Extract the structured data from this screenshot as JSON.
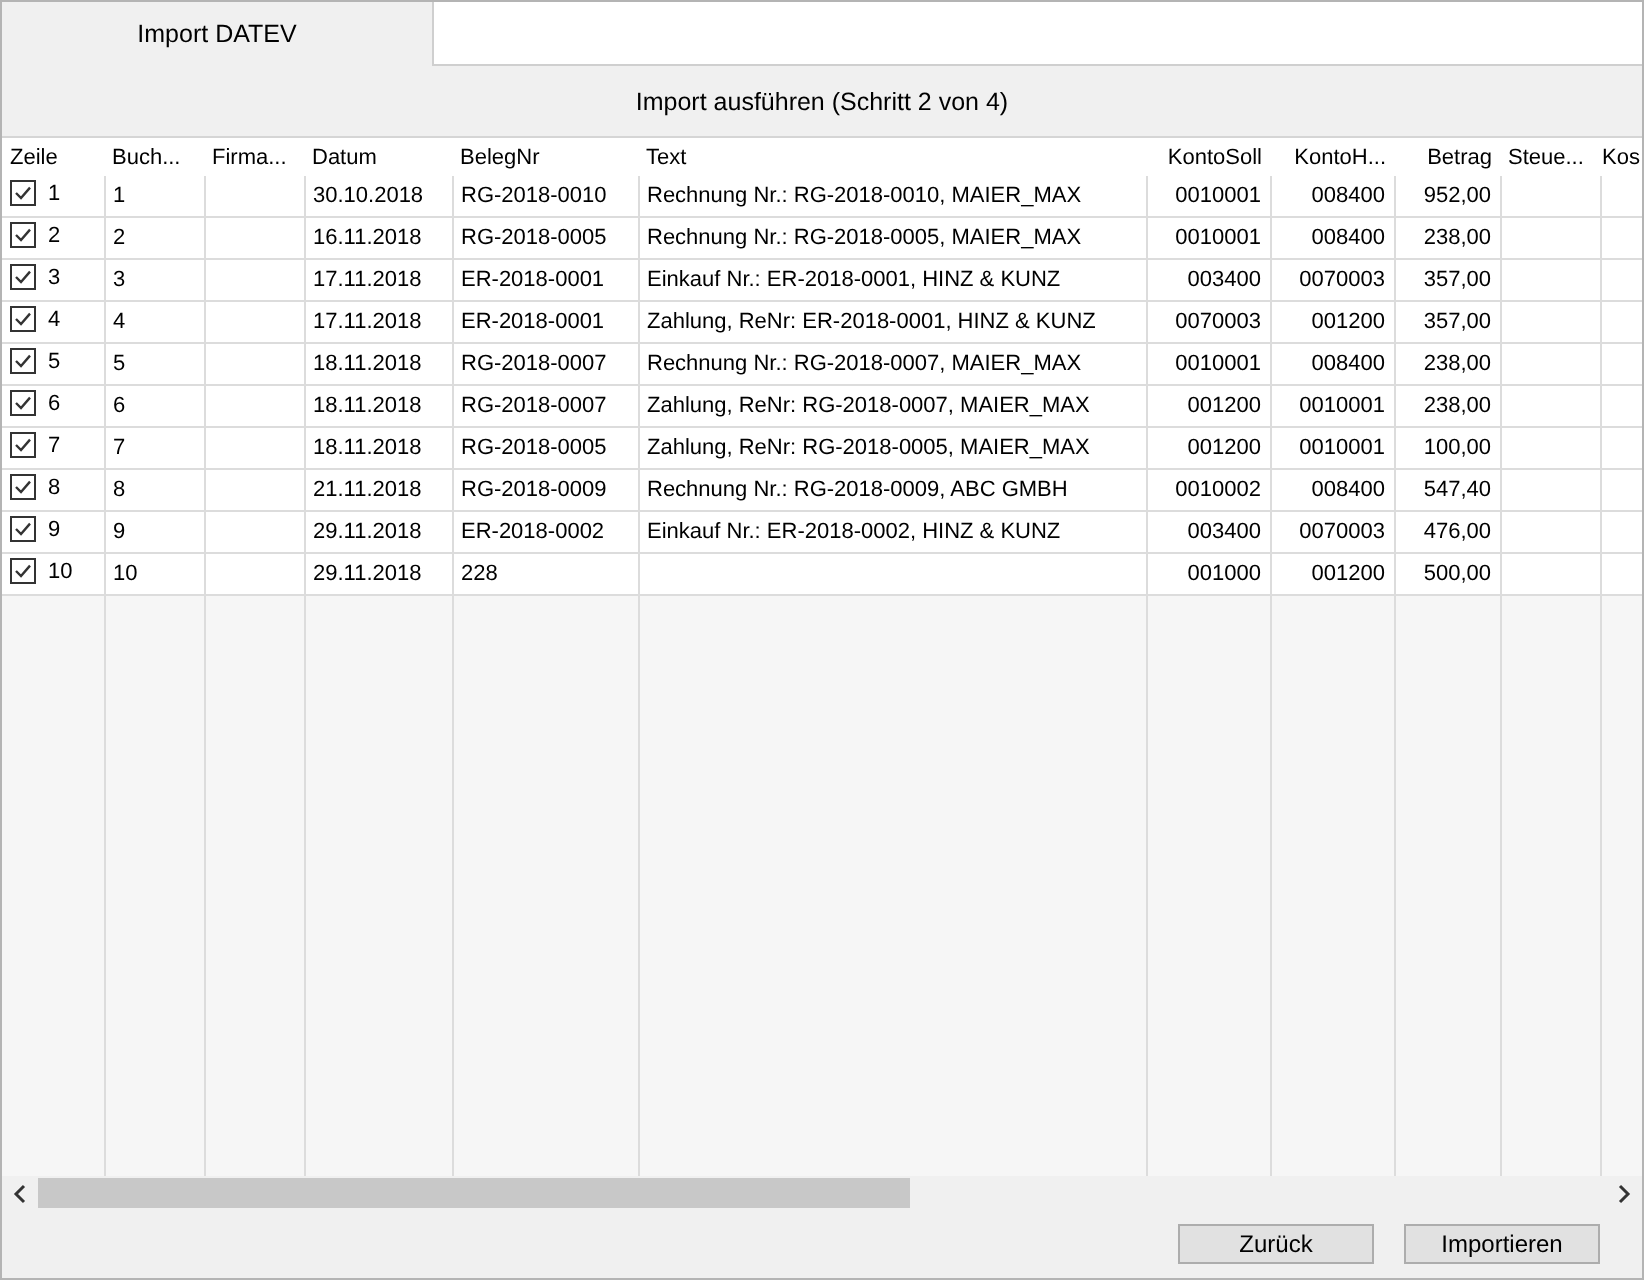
{
  "tabs": [
    {
      "label": "Import DATEV",
      "selected": true
    }
  ],
  "step_title": "Import ausführen (Schritt 2 von 4)",
  "table": {
    "columns": [
      "Zeile",
      "Buch...",
      "Firma...",
      "Datum",
      "BelegNr",
      "Text",
      "KontoSoll",
      "KontoH...",
      "Betrag",
      "Steue...",
      "Kos"
    ],
    "rows": [
      {
        "checked": true,
        "cells": [
          "1",
          "1",
          null,
          "30.10.2018",
          "RG-2018-0010",
          "Rechnung Nr.: RG-2018-0010, MAIER_MAX",
          "0010001",
          "008400",
          "952,00",
          null,
          null
        ]
      },
      {
        "checked": true,
        "cells": [
          "2",
          "2",
          null,
          "16.11.2018",
          "RG-2018-0005",
          "Rechnung Nr.: RG-2018-0005, MAIER_MAX",
          "0010001",
          "008400",
          "238,00",
          null,
          null
        ]
      },
      {
        "checked": true,
        "cells": [
          "3",
          "3",
          null,
          "17.11.2018",
          "ER-2018-0001",
          "Einkauf Nr.: ER-2018-0001, HINZ & KUNZ",
          "003400",
          "0070003",
          "357,00",
          null,
          null
        ]
      },
      {
        "checked": true,
        "cells": [
          "4",
          "4",
          null,
          "17.11.2018",
          "ER-2018-0001",
          "Zahlung, ReNr: ER-2018-0001, HINZ & KUNZ",
          "0070003",
          "001200",
          "357,00",
          null,
          null
        ]
      },
      {
        "checked": true,
        "cells": [
          "5",
          "5",
          null,
          "18.11.2018",
          "RG-2018-0007",
          "Rechnung Nr.: RG-2018-0007, MAIER_MAX",
          "0010001",
          "008400",
          "238,00",
          null,
          null
        ]
      },
      {
        "checked": true,
        "cells": [
          "6",
          "6",
          null,
          "18.11.2018",
          "RG-2018-0007",
          "Zahlung, ReNr: RG-2018-0007, MAIER_MAX",
          "001200",
          "0010001",
          "238,00",
          null,
          null
        ]
      },
      {
        "checked": true,
        "cells": [
          "7",
          "7",
          null,
          "18.11.2018",
          "RG-2018-0005",
          "Zahlung, ReNr: RG-2018-0005, MAIER_MAX",
          "001200",
          "0010001",
          "100,00",
          null,
          null
        ]
      },
      {
        "checked": true,
        "cells": [
          "8",
          "8",
          null,
          "21.11.2018",
          "RG-2018-0009",
          "Rechnung Nr.: RG-2018-0009, ABC GMBH",
          "0010002",
          "008400",
          "547,40",
          null,
          null
        ]
      },
      {
        "checked": true,
        "cells": [
          "9",
          "9",
          null,
          "29.11.2018",
          "ER-2018-0002",
          "Einkauf Nr.: ER-2018-0002, HINZ & KUNZ",
          "003400",
          "0070003",
          "476,00",
          null,
          null
        ]
      },
      {
        "checked": true,
        "cells": [
          "10",
          "10",
          null,
          "29.11.2018",
          "228",
          null,
          "001000",
          "001200",
          "500,00",
          null,
          null
        ]
      }
    ]
  },
  "buttons": [
    "Zurück",
    "Importieren"
  ]
}
